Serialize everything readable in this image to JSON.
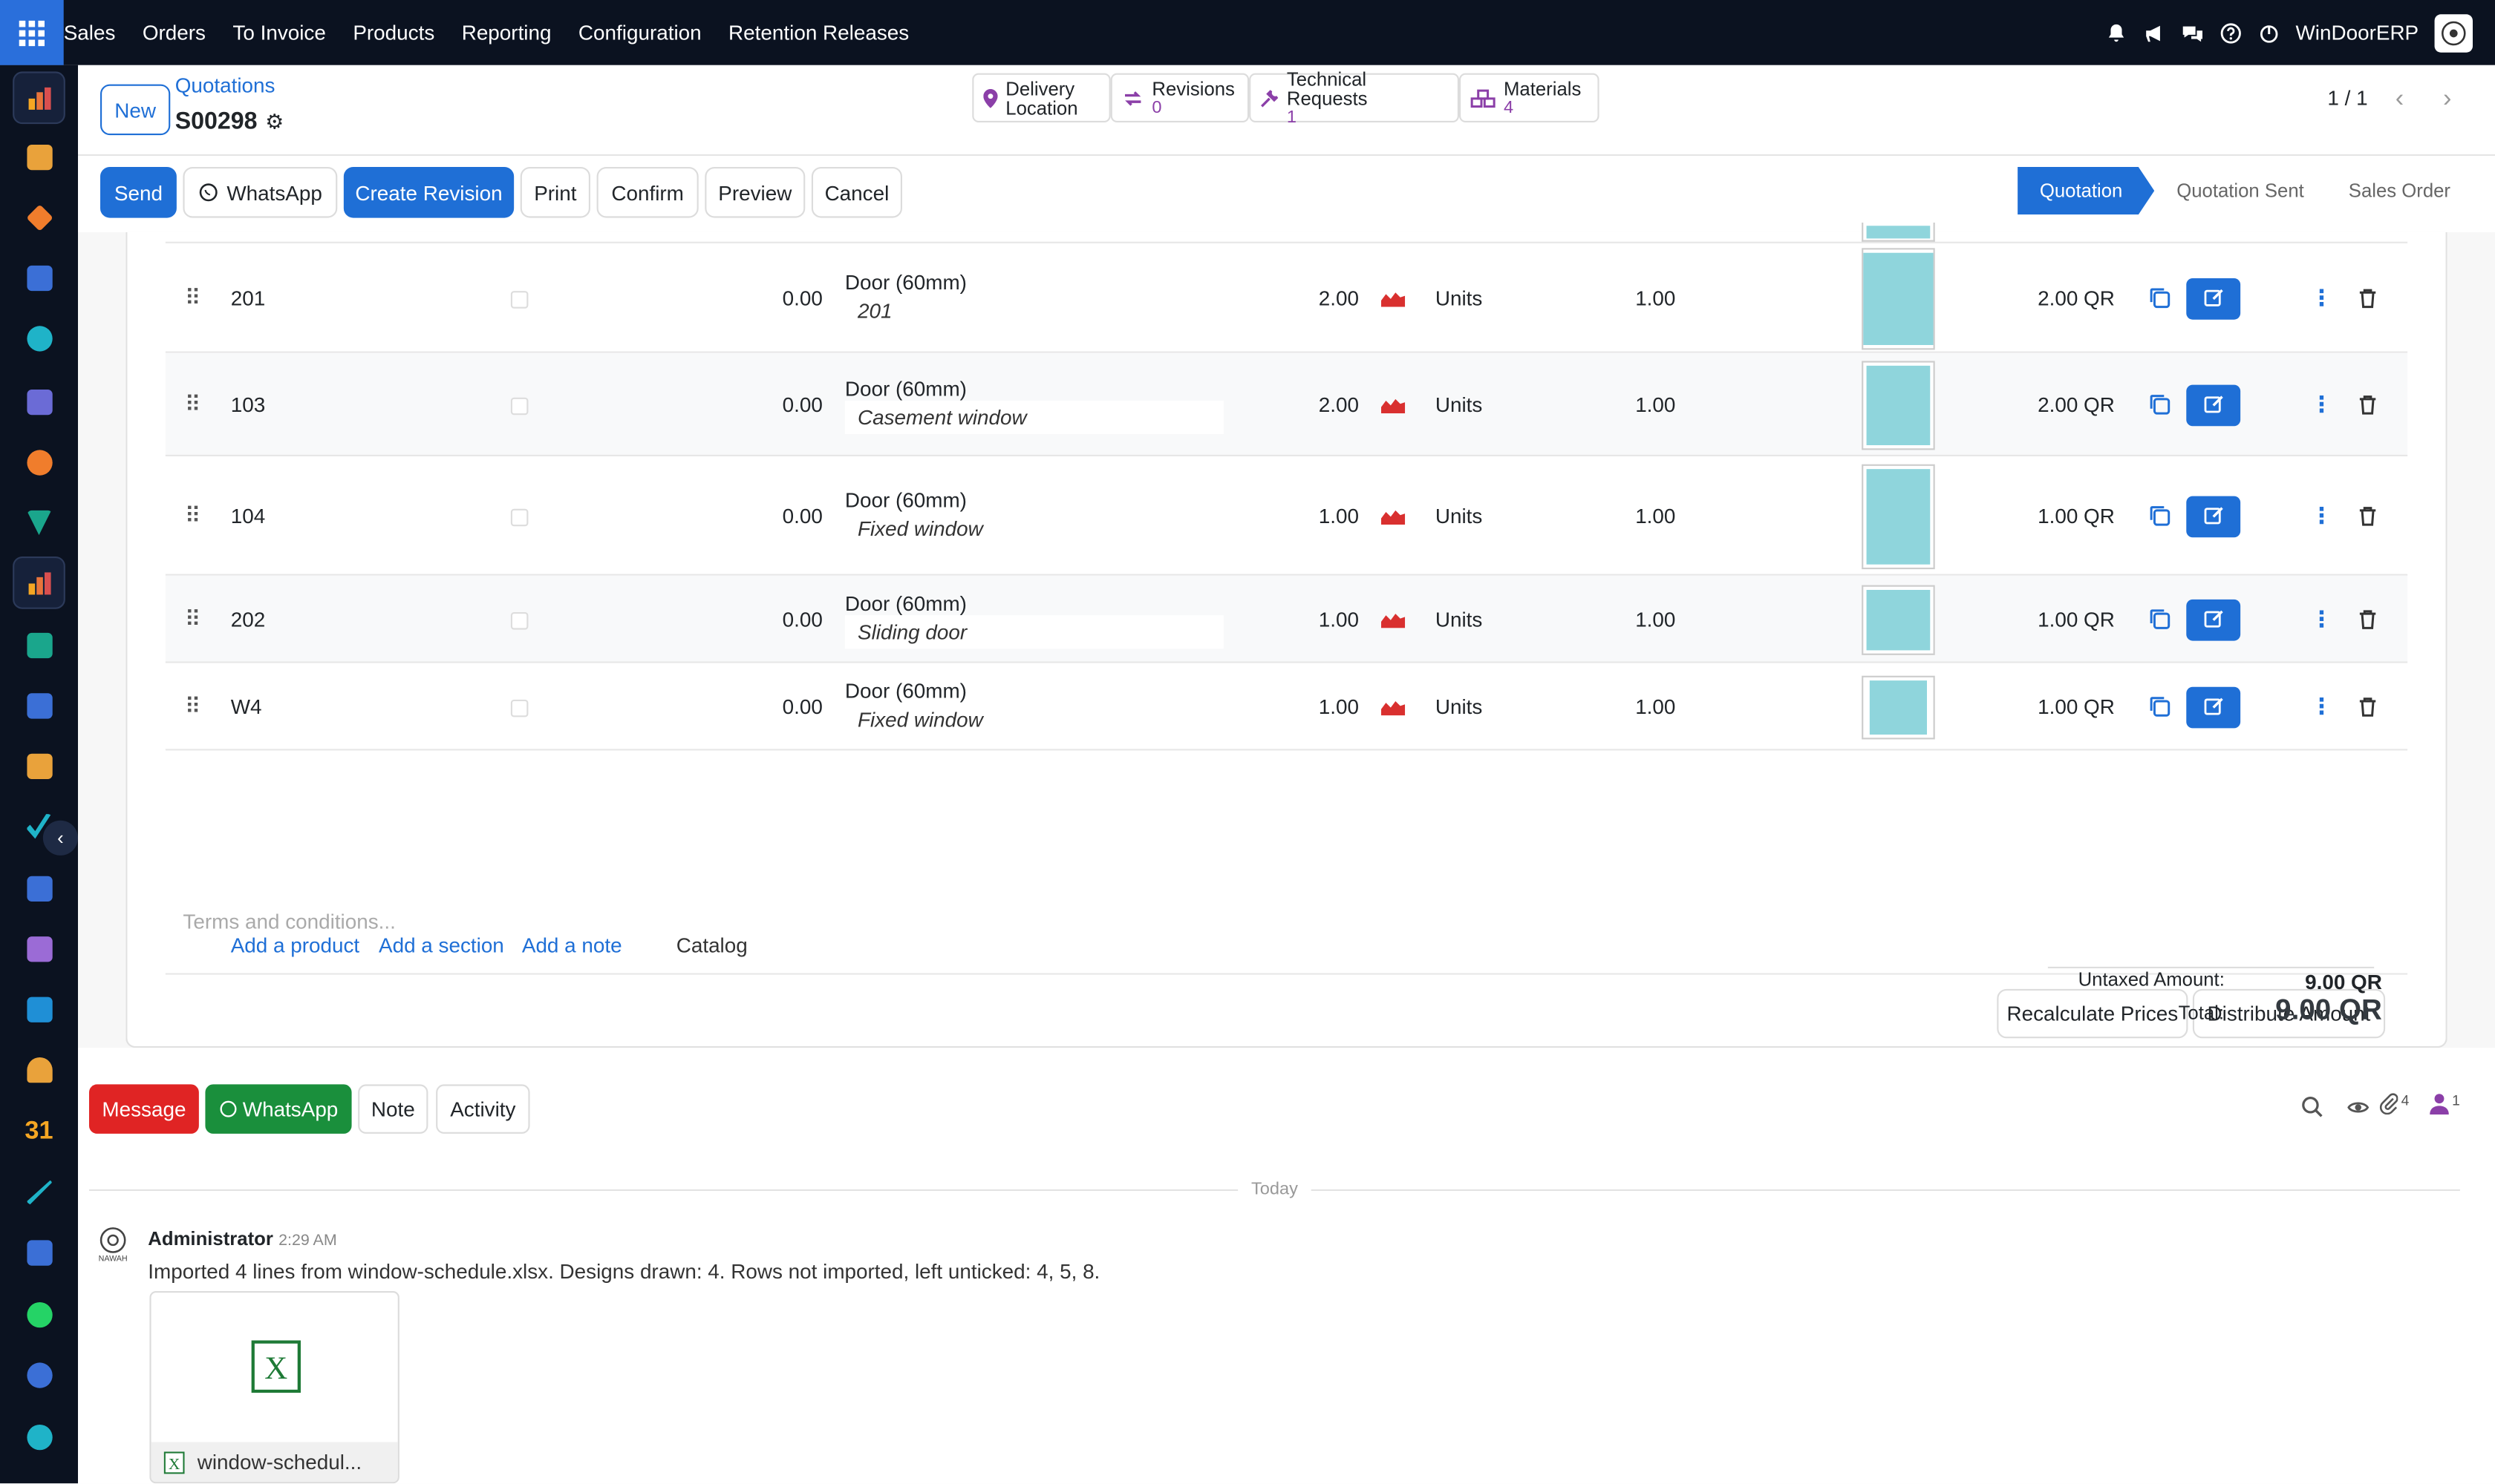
{
  "topbar": {
    "menu": [
      "Sales",
      "Orders",
      "To Invoice",
      "Products",
      "Reporting",
      "Configuration",
      "Retention Releases"
    ],
    "company": "WinDoorERP"
  },
  "breadcrumb": {
    "parent": "Quotations",
    "current": "S00298"
  },
  "buttons": {
    "new": "New",
    "send": "Send",
    "whatsapp": "WhatsApp",
    "create_revision": "Create Revision",
    "print": "Print",
    "confirm": "Confirm",
    "preview": "Preview",
    "cancel": "Cancel"
  },
  "smart_buttons": [
    {
      "label": "Delivery",
      "label2": "Location"
    },
    {
      "label": "Revisions",
      "value": "0"
    },
    {
      "label": "Technical Requests",
      "value": "1"
    },
    {
      "label": "Materials",
      "value": "4"
    }
  ],
  "pager": {
    "text": "1 / 1"
  },
  "status": [
    "Quotation",
    "Quotation Sent",
    "Sales Order"
  ],
  "lines": [
    {
      "ref": "201",
      "disc": "0.00",
      "product": "Door (60mm)",
      "desc": "201",
      "qty": "2.00",
      "uom": "Units",
      "price": "1.00",
      "subtotal": "2.00 QR"
    },
    {
      "ref": "103",
      "disc": "0.00",
      "product": "Door (60mm)",
      "desc": "Casement window",
      "qty": "2.00",
      "uom": "Units",
      "price": "1.00",
      "subtotal": "2.00 QR"
    },
    {
      "ref": "104",
      "disc": "0.00",
      "product": "Door (60mm)",
      "desc": "Fixed window",
      "qty": "1.00",
      "uom": "Units",
      "price": "1.00",
      "subtotal": "1.00 QR"
    },
    {
      "ref": "202",
      "disc": "0.00",
      "product": "Door (60mm)",
      "desc": "Sliding door",
      "qty": "1.00",
      "uom": "Units",
      "price": "1.00",
      "subtotal": "1.00 QR"
    },
    {
      "ref": "W4",
      "disc": "0.00",
      "product": "Door (60mm)",
      "desc": "Fixed window",
      "qty": "1.00",
      "uom": "Units",
      "price": "1.00",
      "subtotal": "1.00 QR"
    }
  ],
  "add_links": {
    "product": "Add a product",
    "section": "Add a section",
    "note": "Add a note",
    "catalog": "Catalog"
  },
  "actions": {
    "recalc": "Recalculate Prices",
    "distribute": "Distribute Amount"
  },
  "terms_placeholder": "Terms and conditions...",
  "totals": {
    "untaxed_label": "Untaxed Amount:",
    "untaxed": "9.00 QR",
    "total_label": "Total:",
    "total": "9.00 QR"
  },
  "chatter": {
    "message": "Message",
    "whatsapp": "WhatsApp",
    "note": "Note",
    "activity": "Activity",
    "attach_count": "4",
    "follower_count": "1",
    "today": "Today",
    "author": "Administrator",
    "time": "2:29 AM",
    "body": "Imported 4 lines from window-schedule.xlsx. Designs drawn: 4. Rows not imported, left unticked: 4, 5, 8.",
    "file": "window-schedul...",
    "avatar_text": "NAWAH"
  },
  "colors": {
    "primary": "#1f6fd6",
    "topbar": "#0b1220",
    "danger": "#e02424",
    "success": "#1a8f3c",
    "thumb": "#8fd5dc"
  }
}
